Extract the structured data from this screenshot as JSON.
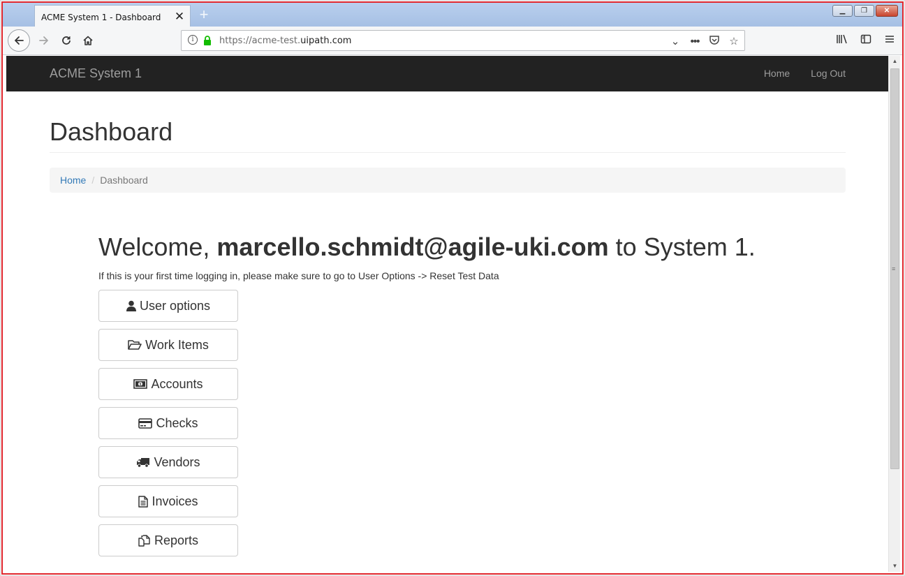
{
  "browser": {
    "tab_title": "ACME System 1 - Dashboard",
    "tab_close": "✕",
    "new_tab": "+",
    "url_prefix": "https://acme-test.",
    "url_domain": "uipath.com",
    "window_controls": [
      "minimize",
      "restore",
      "close"
    ]
  },
  "navbar": {
    "brand": "ACME System 1",
    "links": [
      "Home",
      "Log Out"
    ]
  },
  "page": {
    "title": "Dashboard",
    "breadcrumb": {
      "home": "Home",
      "separator": "/",
      "current": "Dashboard"
    },
    "welcome_prefix": "Welcome, ",
    "welcome_user": "marcello.schmidt@agile-uki.com",
    "welcome_suffix": " to System 1.",
    "note": "If this is your first time logging in, please make sure to go to User Options -> Reset Test Data"
  },
  "menu": {
    "user_options": {
      "label": "User options",
      "icon": "user-icon"
    },
    "work_items": {
      "label": "Work Items",
      "icon": "folder-open-icon"
    },
    "accounts": {
      "label": "Accounts",
      "icon": "money-icon"
    },
    "checks": {
      "label": "Checks",
      "icon": "credit-card-icon"
    },
    "vendors": {
      "label": "Vendors",
      "icon": "truck-icon"
    },
    "invoices": {
      "label": "Invoices",
      "icon": "file-text-icon"
    },
    "reports": {
      "label": "Reports",
      "icon": "copy-icon"
    }
  },
  "colors": {
    "navbar_bg": "#222222",
    "navbar_text": "#9d9d9d",
    "link": "#337ab7",
    "breadcrumb_bg": "#f5f5f5",
    "window_border": "#e0272d"
  }
}
